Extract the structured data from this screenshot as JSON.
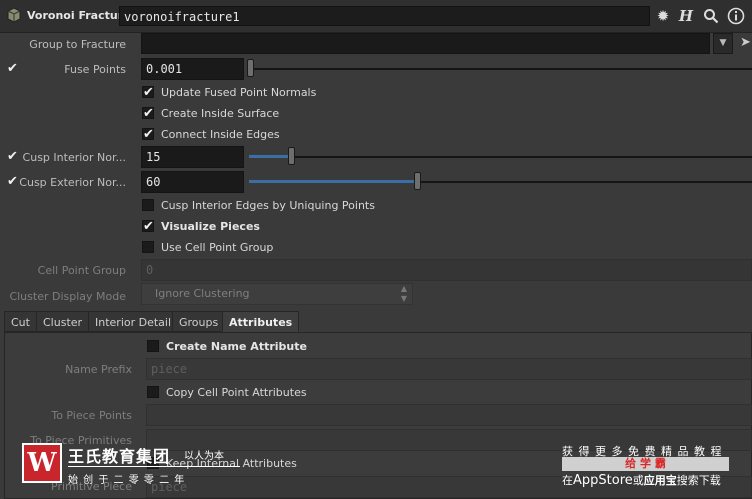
{
  "header": {
    "node_type": "Voronoi Fracture",
    "node_name": "voronoifracture1",
    "icons": [
      "gear-icon",
      "help-h-icon",
      "search-icon",
      "info-icon"
    ]
  },
  "params": {
    "group_to_fracture": {
      "label": "Group to Fracture",
      "value": ""
    },
    "fuse_points": {
      "label": "Fuse Points",
      "value": "0.001",
      "enabled": true
    },
    "update_fused": {
      "label": "Update Fused Point Normals",
      "checked": true
    },
    "create_inside": {
      "label": "Create Inside Surface",
      "checked": true
    },
    "connect_inside": {
      "label": "Connect Inside Edges",
      "checked": true
    },
    "cusp_interior": {
      "label": "Cusp Interior Nor...",
      "value": "15",
      "enabled": true
    },
    "cusp_exterior": {
      "label": "Cusp Exterior Nor...",
      "value": "60",
      "enabled": true
    },
    "cusp_uniquing": {
      "label": "Cusp Interior Edges by Uniquing Points",
      "checked": false
    },
    "visualize": {
      "label": "Visualize Pieces",
      "checked": true
    },
    "use_cell_group": {
      "label": "Use Cell Point Group",
      "checked": false
    },
    "cell_point_group": {
      "label": "Cell Point Group",
      "value": "0"
    },
    "cluster_mode": {
      "label": "Cluster Display Mode",
      "value": "Ignore Clustering"
    }
  },
  "tabs": [
    "Cut",
    "Cluster",
    "Interior Detail",
    "Groups",
    "Attributes"
  ],
  "active_tab": "Attributes",
  "attributes": {
    "create_name": {
      "label": "Create Name Attribute",
      "checked": false
    },
    "name_prefix": {
      "label": "Name Prefix",
      "value": "piece"
    },
    "copy_cell": {
      "label": "Copy Cell Point Attributes",
      "checked": false
    },
    "to_piece_points": {
      "label": "To Piece Points"
    },
    "to_piece_primitives": {
      "label": "To Piece Primitives"
    },
    "keep_internal": {
      "label": "Keep Internal Attributes"
    },
    "primitive_piece": {
      "label": "Primitive Piece",
      "value": "piece"
    }
  },
  "watermark": {
    "logo": "W",
    "brand": "王氏教育集团",
    "slogan": "以人为本",
    "subline": "始 创 于 二 零 零 二 年",
    "promo_top": "获 得 更 多 免 费 精 品 教 程",
    "promo_badge": "给 学 霸",
    "promo_bottom_1": "在",
    "promo_bottom_2": "AppStore",
    "promo_bottom_3": "或",
    "promo_bottom_4": "应用宝",
    "promo_bottom_5": "搜索下载"
  },
  "colors": {
    "slider_fill": "#3b6ea5",
    "badge": "#d82a2a",
    "logo_red": "#c8262c"
  }
}
